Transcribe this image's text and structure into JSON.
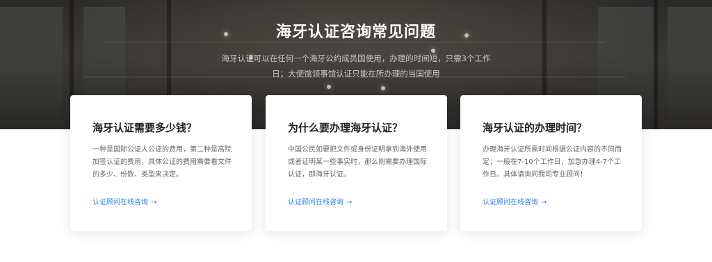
{
  "hero": {
    "title": "海牙认证咨询常见问题",
    "description_line1": "海牙认证可以在任何一个海牙公约成员国使用，办理的时间短，只需3个工作",
    "description_line2": "日；大使馆领事馆认证只能在所办理的当国使用"
  },
  "cards": [
    {
      "title": "海牙认证需要多少钱？",
      "text": "一种是国际公证人公证的费用，第二种是高院加签认证的费用，具体公证的费用需要看文件的多少、份数、类型来决定。",
      "link": "认证顾问在线咨询",
      "arrow": "→"
    },
    {
      "title": "为什么要办理海牙认证？",
      "text": "中国公民如要把文件或身份证明拿到海外使用或者证明某一些事实时，那么则需要办理国际认证，即海牙认证。",
      "link": "认证顾问在线咨询",
      "arrow": "→"
    },
    {
      "title": "海牙认证的办理时间？",
      "text": "办理海牙认证所需时间根据公证内容的不同而定；一般在7-10个工作日，加急办理4-7个工作日。具体请询问我司专业顾问！",
      "link": "认证顾问在线咨询",
      "arrow": "→"
    }
  ],
  "colors": {
    "link": "#2b7de1",
    "title": "#222222",
    "text": "#666666"
  }
}
